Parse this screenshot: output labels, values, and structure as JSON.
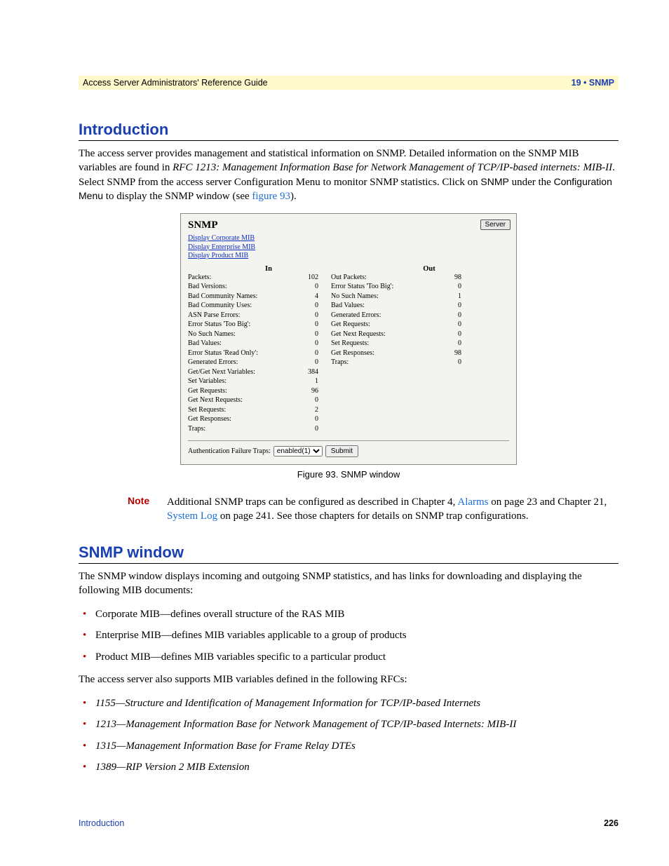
{
  "header": {
    "left": "Access Server Administrators' Reference Guide",
    "right": "19 • SNMP"
  },
  "intro": {
    "heading": "Introduction",
    "p1_a": "The access server provides management and statistical information on SNMP. Detailed information on the SNMP MIB variables are found in ",
    "p1_rfc": "RFC 1213: Management Information Base for Network Management of TCP/IP-based internets: MIB-II",
    "p1_b": ". Select SNMP from the access server Configuration Menu to monitor SNMP statistics. Click on ",
    "p1_sans1": "SNMP",
    "p1_c": " under the ",
    "p1_sans2": "Configuration Menu",
    "p1_d": " to display the SNMP window (see ",
    "p1_link": "figure 93",
    "p1_e": ")."
  },
  "figure": {
    "title": "SNMP",
    "server_btn": "Server",
    "links": [
      "Display Corporate MIB",
      "Display Enterprise MIB",
      "Display Product MIB"
    ],
    "hdr_in": "In",
    "hdr_out": "Out",
    "in_rows": [
      {
        "l": "Packets:",
        "v": "102"
      },
      {
        "l": "Bad Versions:",
        "v": "0"
      },
      {
        "l": "Bad Community Names:",
        "v": "4"
      },
      {
        "l": "Bad Community Uses:",
        "v": "0"
      },
      {
        "l": "ASN Parse Errors:",
        "v": "0"
      },
      {
        "l": "Error Status 'Too Big':",
        "v": "0"
      },
      {
        "l": "No Such Names:",
        "v": "0"
      },
      {
        "l": "Bad Values:",
        "v": "0"
      },
      {
        "l": "Error Status 'Read Only':",
        "v": "0"
      },
      {
        "l": "Generated Errors:",
        "v": "0"
      },
      {
        "l": "Get/Get Next Variables:",
        "v": "384"
      },
      {
        "l": "Set Variables:",
        "v": "1"
      },
      {
        "l": "Get Requests:",
        "v": "96"
      },
      {
        "l": "Get Next Requests:",
        "v": "0"
      },
      {
        "l": "Set Requests:",
        "v": "2"
      },
      {
        "l": "Get Responses:",
        "v": "0"
      },
      {
        "l": "Traps:",
        "v": "0"
      }
    ],
    "out_rows": [
      {
        "l": "Out Packets:",
        "v": "98"
      },
      {
        "l": "Error Status 'Too Big':",
        "v": "0"
      },
      {
        "l": "No Such Names:",
        "v": "1"
      },
      {
        "l": "Bad Values:",
        "v": "0"
      },
      {
        "l": "Generated Errors:",
        "v": "0"
      },
      {
        "l": "Get Requests:",
        "v": "0"
      },
      {
        "l": "Get Next Requests:",
        "v": "0"
      },
      {
        "l": "Set Requests:",
        "v": "0"
      },
      {
        "l": "Get Responses:",
        "v": "98"
      },
      {
        "l": "Traps:",
        "v": "0"
      }
    ],
    "auth_label": "Authentication Failure Traps:",
    "auth_select": "enabled(1)",
    "submit": "Submit",
    "caption": "Figure 93. SNMP window"
  },
  "note": {
    "label": "Note",
    "t1": "Additional SNMP traps can be configured as described in Chapter 4, ",
    "link1": "Alarms",
    "t2": " on page 23 and Chapter 21, ",
    "link2": "System Log",
    "t3": " on page 241. See those chapters for details on SNMP trap configurations."
  },
  "snmp": {
    "heading": "SNMP window",
    "p1": "The SNMP window displays incoming and outgoing SNMP statistics, and has links for downloading and displaying the following MIB documents:",
    "bullets1": [
      "Corporate MIB—defines overall structure of the RAS MIB",
      "Enterprise MIB—defines MIB variables applicable to a group of products",
      "Product MIB—defines MIB variables specific to a particular product"
    ],
    "p2": "The access server also supports MIB variables defined in the following RFCs:",
    "bullets2": [
      "1155—Structure and Identification of Management Information for TCP/IP-based Internets",
      "1213—Management Information Base for Network Management of TCP/IP-based Internets: MIB-II",
      "1315—Management Information Base for Frame Relay DTEs",
      "1389—RIP Version 2 MIB Extension"
    ]
  },
  "footer": {
    "left": "Introduction",
    "right": "226"
  }
}
